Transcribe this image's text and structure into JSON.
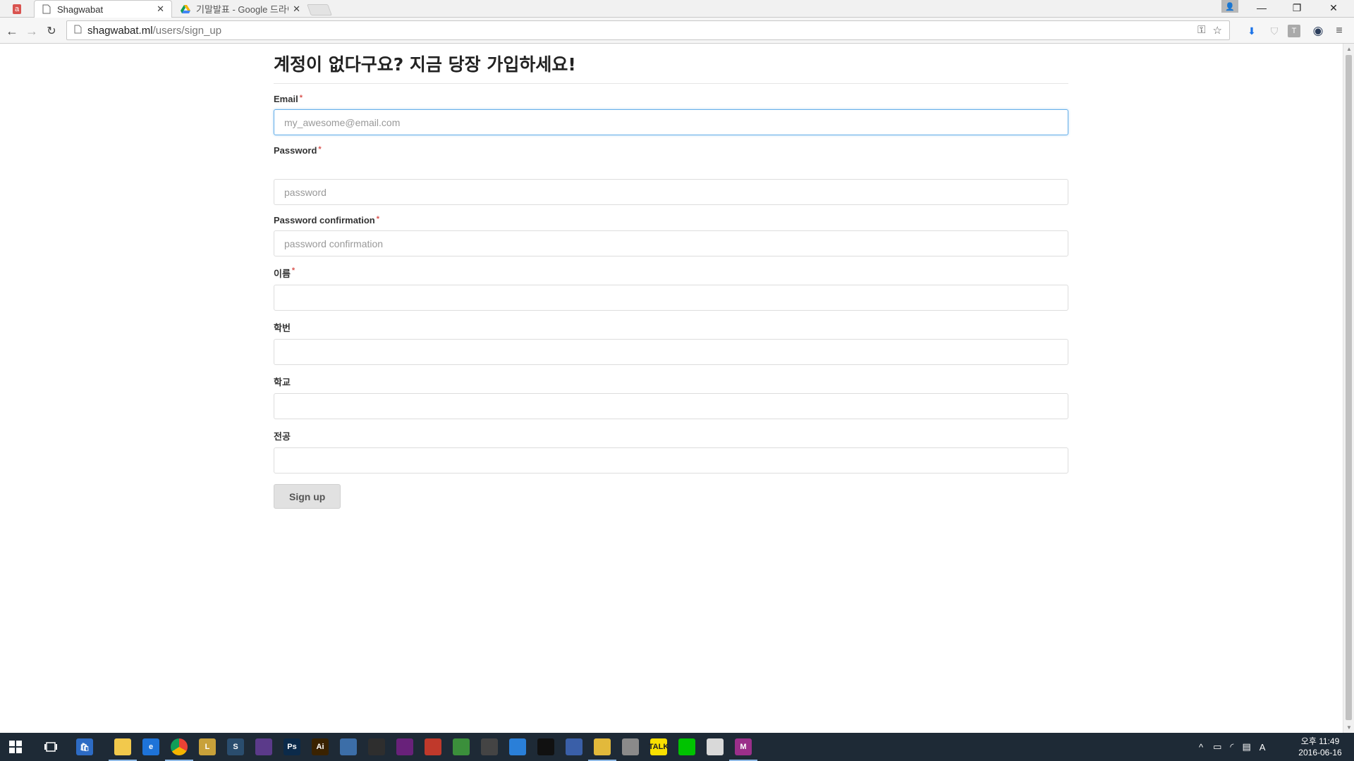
{
  "browser": {
    "tabs": [
      {
        "title": "Shagwabat",
        "active": true
      },
      {
        "title": "기말발표 - Google 드라이",
        "active": false
      }
    ],
    "url_host": "shagwabat.ml",
    "url_path": "/users/sign_up"
  },
  "page": {
    "heading": "계정이 없다구요? 지금 당장 가입하세요!",
    "required_mark": "*",
    "fields": {
      "email": {
        "label": "Email",
        "placeholder": "my_awesome@email.com"
      },
      "password": {
        "label": "Password",
        "placeholder": "password"
      },
      "password_confirmation": {
        "label": "Password confirmation",
        "placeholder": "password confirmation"
      },
      "name": {
        "label": "이름",
        "placeholder": ""
      },
      "student_id": {
        "label": "학번",
        "placeholder": ""
      },
      "school": {
        "label": "학교",
        "placeholder": ""
      },
      "major": {
        "label": "전공",
        "placeholder": ""
      }
    },
    "submit_label": "Sign up"
  },
  "taskbar": {
    "clock_time": "오후 11:49",
    "clock_date": "2016-06-16",
    "ime": "A",
    "apps": [
      {
        "icon": "file-explorer-icon",
        "label": "",
        "color": "#f2c94c"
      },
      {
        "icon": "edge-icon",
        "label": "e",
        "color": "#1e73d8"
      },
      {
        "icon": "chrome-icon",
        "label": "",
        "color": "#e94235"
      },
      {
        "icon": "lol-icon",
        "label": "L",
        "color": "#c8a13a"
      },
      {
        "icon": "app-icon",
        "label": "S",
        "color": "#2a4d6e"
      },
      {
        "icon": "app-icon",
        "label": "",
        "color": "#5b3a8a"
      },
      {
        "icon": "photoshop-icon",
        "label": "Ps",
        "color": "#0b2a4a"
      },
      {
        "icon": "illustrator-icon",
        "label": "Ai",
        "color": "#3a2200"
      },
      {
        "icon": "virtualbox-icon",
        "label": "",
        "color": "#3c6ea8"
      },
      {
        "icon": "unity-icon",
        "label": "",
        "color": "#2e2e2e"
      },
      {
        "icon": "visual-studio-icon",
        "label": "",
        "color": "#68217a"
      },
      {
        "icon": "ruby-icon",
        "label": "",
        "color": "#c0392b"
      },
      {
        "icon": "sublime-icon",
        "label": "",
        "color": "#3b8f3b"
      },
      {
        "icon": "snipping-tool-icon",
        "label": "",
        "color": "#444444"
      },
      {
        "icon": "notepad-icon",
        "label": "",
        "color": "#2a7fd8"
      },
      {
        "icon": "terminal-icon",
        "label": "",
        "color": "#111111"
      },
      {
        "icon": "app-icon",
        "label": "",
        "color": "#3a5fa8"
      },
      {
        "icon": "folder-icon",
        "label": "",
        "color": "#e2b93b"
      },
      {
        "icon": "app-icon",
        "label": "",
        "color": "#8a8a8a"
      },
      {
        "icon": "kakaotalk-icon",
        "label": "TALK",
        "color": "#f9e000"
      },
      {
        "icon": "line-icon",
        "label": "",
        "color": "#00c300"
      },
      {
        "icon": "app-icon",
        "label": "",
        "color": "#d9d9d9"
      },
      {
        "icon": "app-icon",
        "label": "M",
        "color": "#9b2f8a"
      }
    ]
  }
}
